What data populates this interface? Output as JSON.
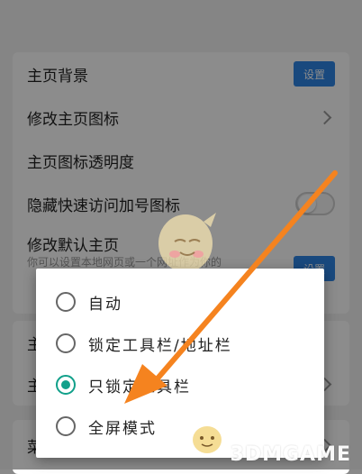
{
  "settings": {
    "items": [
      {
        "label": "主页背景",
        "button": "设置"
      },
      {
        "label": "修改主页图标"
      },
      {
        "label": "主页图标透明度"
      },
      {
        "label": "隐藏快速访问加号图标"
      },
      {
        "label": "修改默认主页",
        "sub": "你可以设置本地网页或一个网址作为你的",
        "button": "设置"
      }
    ],
    "partial_labels": [
      "主",
      "主",
      "菜"
    ]
  },
  "dialog": {
    "options": [
      {
        "label": "自动",
        "selected": false
      },
      {
        "label": "锁定工具栏/地址栏",
        "selected": false
      },
      {
        "label": "只锁定工具栏",
        "selected": true
      },
      {
        "label": "全屏模式",
        "selected": false
      }
    ]
  },
  "watermark": "3DMGAME",
  "colors": {
    "accent": "#11a08a",
    "button": "#2f86e6",
    "arrow": "#f5831f"
  }
}
